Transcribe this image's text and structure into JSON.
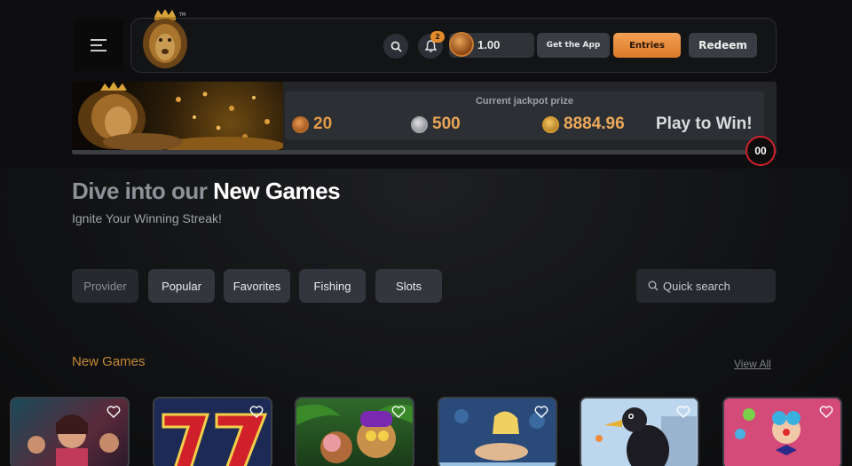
{
  "header": {
    "menu_icon": "hamburger-icon",
    "logo_icon": "lion-king-logo",
    "trademark": "TM",
    "notification_count": "2",
    "balance": "1.00",
    "get_app_label": "Get the App",
    "entries_label": "Entries",
    "redeem_label": "Redeem"
  },
  "jackpot": {
    "label": "Current jackpot prize",
    "values": [
      "20",
      "500",
      "8884.96"
    ],
    "cta": "Play to Win!",
    "timer": "00"
  },
  "hero": {
    "title_dim": "Dive into our",
    "title_bright": "New Games",
    "subtitle": "Ignite Your Winning Streak!"
  },
  "filters": {
    "chips": [
      "Provider",
      "Popular",
      "Favorites",
      "Fishing",
      "Slots"
    ],
    "search_placeholder": "Quick search"
  },
  "section": {
    "title": "New Games",
    "view_all": "View All"
  },
  "colors": {
    "accent": "#e58a2a",
    "section_title": "#c48934",
    "timer_ring": "#d0222b"
  }
}
